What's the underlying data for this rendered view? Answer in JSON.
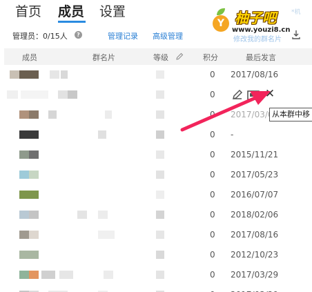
{
  "tabs": [
    {
      "label": "首页"
    },
    {
      "label": "成员"
    },
    {
      "label": "设置"
    }
  ],
  "logo": {
    "badge": "Y",
    "name": "柚子吧",
    "url": "www.youzi8.cn",
    "faint": "*机"
  },
  "subbar": {
    "admin_count": "管理员：0/15人",
    "help": "?",
    "manage_log": "管理记录",
    "advanced": "高级管理",
    "faint_link": "修改我的群名片"
  },
  "table": {
    "headers": {
      "member": "成员",
      "card": "群名片",
      "level": "等级",
      "score": "积分",
      "last_msg": "最后发言"
    },
    "rows": [
      {
        "score": "0",
        "date": "2017/08/16"
      },
      {
        "score": "0",
        "date": ""
      },
      {
        "score": "0",
        "date": "2017/03/0"
      },
      {
        "score": "0",
        "date": "-"
      },
      {
        "score": "0",
        "date": "2015/11/21"
      },
      {
        "score": "0",
        "date": "2017/05/23"
      },
      {
        "score": "0",
        "date": "2016/07/07"
      },
      {
        "score": "0",
        "date": "2018/02/06"
      },
      {
        "score": "0",
        "date": "2017/08/16"
      },
      {
        "score": "0",
        "date": "2012/10/23"
      },
      {
        "score": "0",
        "date": "2017/03/29"
      }
    ]
  },
  "row_actions": {
    "remove_glyph": "✕"
  },
  "tooltip": {
    "text": "从本群中移"
  },
  "colors": {
    "accent": "#2a8be0",
    "link": "#2a7fd4",
    "arrow": "#f2245b",
    "header_bg": "#f3f3f3"
  }
}
